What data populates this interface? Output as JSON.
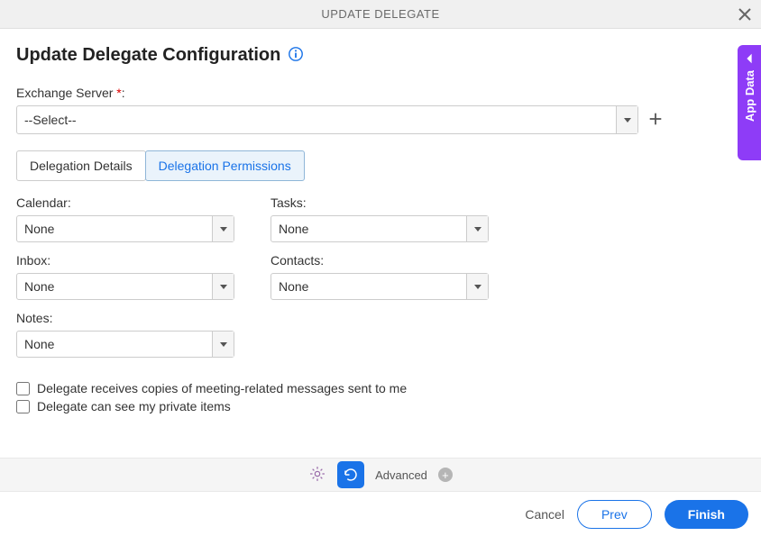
{
  "header": {
    "title": "UPDATE DELEGATE"
  },
  "page": {
    "title": "Update Delegate Configuration"
  },
  "exchange": {
    "label": "Exchange Server ",
    "star": "*",
    "colon": ":",
    "value": "--Select--"
  },
  "tabs": {
    "details": "Delegation Details",
    "permissions": "Delegation Permissions"
  },
  "perm": {
    "calendar": {
      "label": "Calendar:",
      "value": "None"
    },
    "tasks": {
      "label": "Tasks:",
      "value": "None"
    },
    "inbox": {
      "label": "Inbox:",
      "value": "None"
    },
    "contacts": {
      "label": "Contacts:",
      "value": "None"
    },
    "notes": {
      "label": "Notes:",
      "value": "None"
    }
  },
  "checks": {
    "meeting": "Delegate receives copies of meeting-related messages sent to me",
    "private": "Delegate can see my private items"
  },
  "footer": {
    "advanced": "Advanced",
    "cancel": "Cancel",
    "prev": "Prev",
    "finish": "Finish"
  },
  "side": {
    "label": "App Data"
  }
}
